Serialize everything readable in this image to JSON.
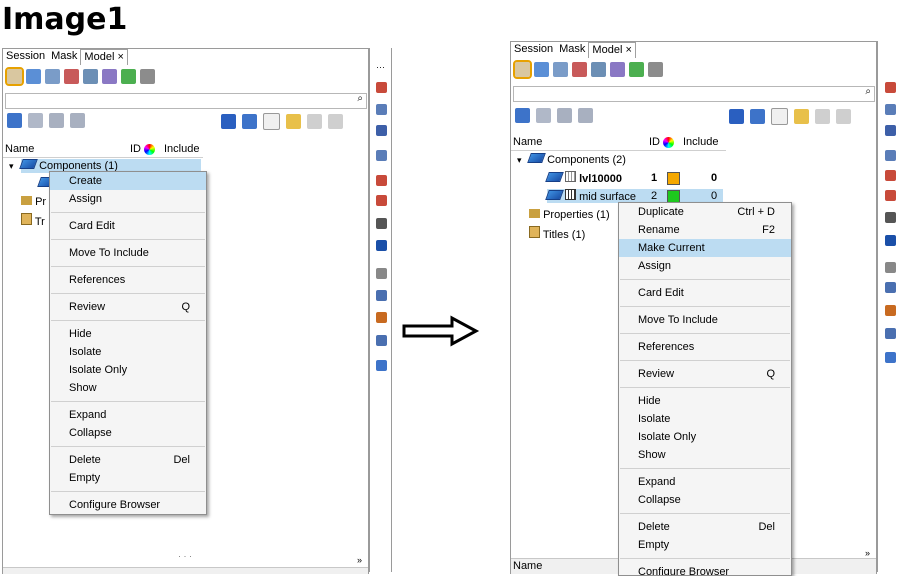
{
  "caption": "Image1",
  "tabs": [
    {
      "label": "Session"
    },
    {
      "label": "Mask"
    },
    {
      "label": "Model ×"
    }
  ],
  "columns": {
    "name": "Name",
    "id": "ID",
    "include": "Include"
  },
  "left": {
    "tree": {
      "components": "Components (1)",
      "properties": "Pr",
      "titles": "Tr"
    },
    "menu": [
      {
        "label": "Create",
        "shortcut": "",
        "highlight": true
      },
      {
        "label": "Assign",
        "shortcut": ""
      },
      {
        "sep": true
      },
      {
        "label": "Card Edit",
        "shortcut": ""
      },
      {
        "sep": true
      },
      {
        "label": "Move To Include",
        "shortcut": ""
      },
      {
        "sep": true
      },
      {
        "label": "References",
        "shortcut": ""
      },
      {
        "sep": true
      },
      {
        "label": "Review",
        "shortcut": "Q"
      },
      {
        "sep": true
      },
      {
        "label": "Hide",
        "shortcut": ""
      },
      {
        "label": "Isolate",
        "shortcut": ""
      },
      {
        "label": "Isolate Only",
        "shortcut": ""
      },
      {
        "label": "Show",
        "shortcut": ""
      },
      {
        "sep": true
      },
      {
        "label": "Expand",
        "shortcut": ""
      },
      {
        "label": "Collapse",
        "shortcut": ""
      },
      {
        "sep": true
      },
      {
        "label": "Delete",
        "shortcut": "Del"
      },
      {
        "label": "Empty",
        "shortcut": ""
      },
      {
        "sep": true
      },
      {
        "label": "Configure Browser",
        "shortcut": ""
      }
    ],
    "footer_dots": "· · ·",
    "footer_chevron": "»"
  },
  "right": {
    "tree": {
      "components": "Components (2)",
      "item1_name": "lvl10000",
      "item1_id": "1",
      "item1_inc": "0",
      "item1_color": "#f5a800",
      "item2_name": "mid surface",
      "item2_id": "2",
      "item2_inc": "0",
      "item2_color": "#1ec81e",
      "properties": "Properties (1)",
      "titles": "Titles (1)"
    },
    "menu": [
      {
        "label": "Duplicate",
        "shortcut": "Ctrl + D"
      },
      {
        "label": "Rename",
        "shortcut": "F2"
      },
      {
        "label": "Make Current",
        "shortcut": "",
        "highlight": true
      },
      {
        "label": "Assign",
        "shortcut": ""
      },
      {
        "sep": true
      },
      {
        "label": "Card Edit",
        "shortcut": ""
      },
      {
        "sep": true
      },
      {
        "label": "Move To Include",
        "shortcut": ""
      },
      {
        "sep": true
      },
      {
        "label": "References",
        "shortcut": ""
      },
      {
        "sep": true
      },
      {
        "label": "Review",
        "shortcut": "Q"
      },
      {
        "sep": true
      },
      {
        "label": "Hide",
        "shortcut": ""
      },
      {
        "label": "Isolate",
        "shortcut": ""
      },
      {
        "label": "Isolate Only",
        "shortcut": ""
      },
      {
        "label": "Show",
        "shortcut": ""
      },
      {
        "sep": true
      },
      {
        "label": "Expand",
        "shortcut": ""
      },
      {
        "label": "Collapse",
        "shortcut": ""
      },
      {
        "sep": true
      },
      {
        "label": "Delete",
        "shortcut": "Del"
      },
      {
        "label": "Empty",
        "shortcut": ""
      },
      {
        "sep": true
      },
      {
        "label": "Configure Browser",
        "shortcut": ""
      }
    ],
    "footer_name": "Name",
    "footer_chevron": "»"
  },
  "colors": {
    "highlight": "#bcdcf2",
    "accent_orange": "#e7a100"
  }
}
